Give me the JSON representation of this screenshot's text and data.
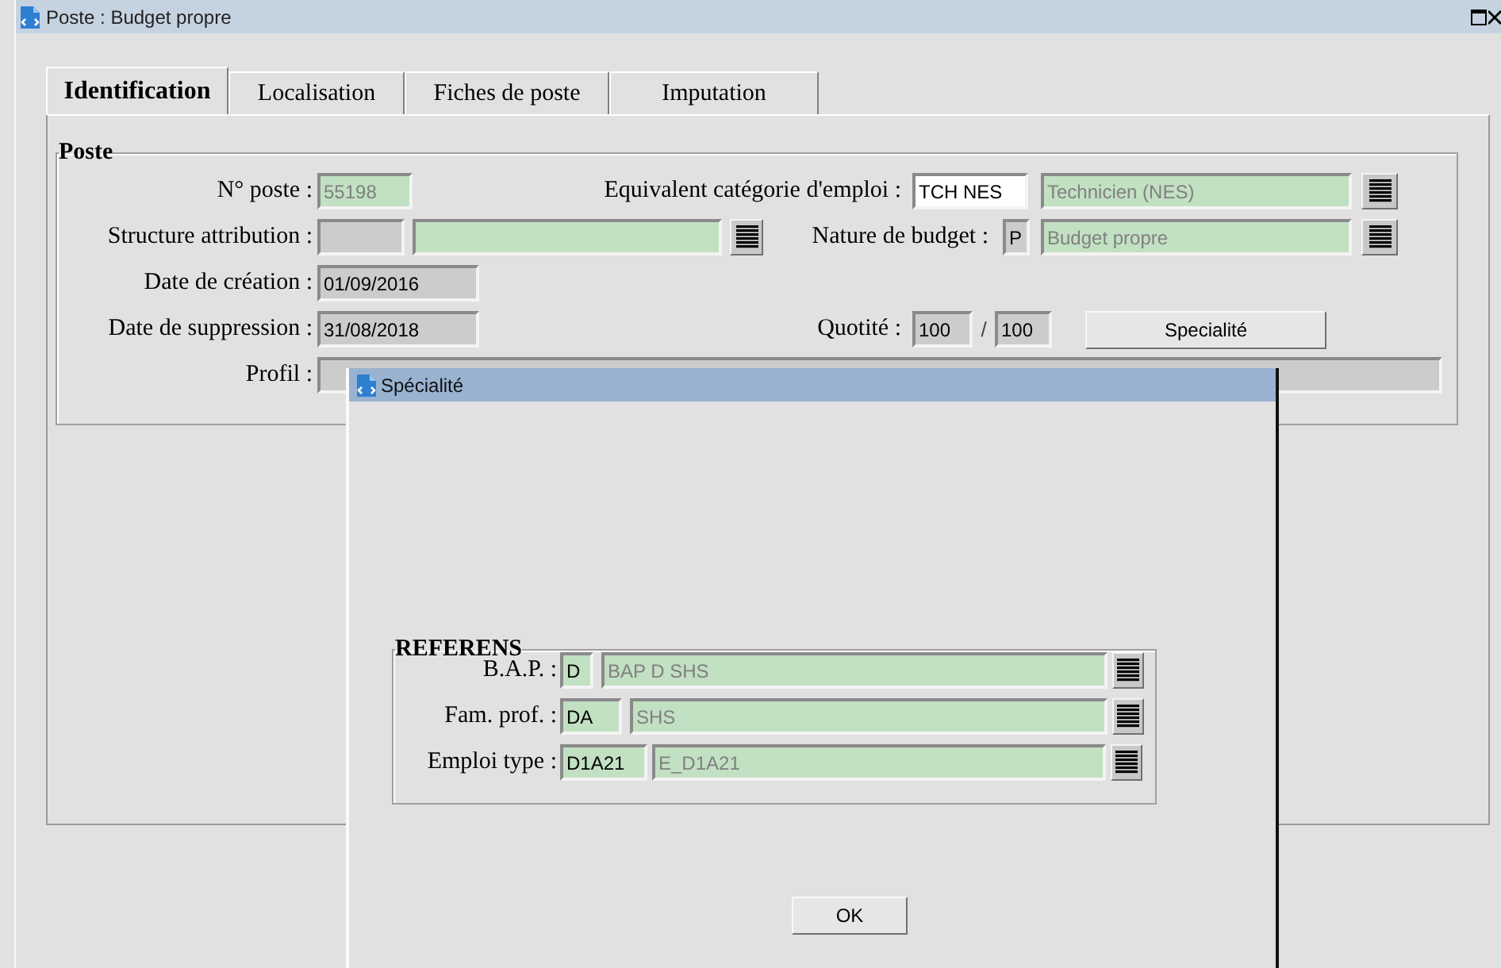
{
  "window": {
    "title": "Poste : Budget propre"
  },
  "tabs": [
    {
      "label": "Identification",
      "selected": true
    },
    {
      "label": "Localisation",
      "selected": false
    },
    {
      "label": "Fiches de poste",
      "selected": false
    },
    {
      "label": "Imputation",
      "selected": false
    }
  ],
  "poste_group": {
    "title": "Poste",
    "rows": [
      {
        "items": [
          {
            "kind": "label",
            "text": "N° poste :"
          },
          {
            "kind": "lookup",
            "value": "55198"
          },
          {
            "kind": "label",
            "text": "Equivalent catégorie d'emploi :"
          },
          {
            "kind": "input",
            "value": "TCH NES"
          },
          {
            "kind": "lookup",
            "value": "Technicien (NES)"
          },
          {
            "kind": "list-button"
          }
        ]
      },
      {
        "items": [
          {
            "kind": "label",
            "text": "Structure attribution :"
          },
          {
            "kind": "locked"
          },
          {
            "kind": "lookup"
          },
          {
            "kind": "list-button"
          },
          {
            "kind": "label",
            "text": "Nature de budget :"
          },
          {
            "kind": "locked",
            "value": "P"
          },
          {
            "kind": "lookup",
            "value": "Budget propre"
          },
          {
            "kind": "list-button"
          }
        ]
      },
      {
        "items": [
          {
            "kind": "label",
            "text": "Date de création :"
          },
          {
            "kind": "locked",
            "value": "01/09/2016"
          }
        ]
      },
      {
        "items": [
          {
            "kind": "label",
            "text": "Date de suppression :"
          },
          {
            "kind": "locked",
            "value": "31/08/2018"
          },
          {
            "kind": "label",
            "text": "Quotité :"
          },
          {
            "kind": "locked",
            "value": "100"
          },
          {
            "kind": "slash",
            "text": "/"
          },
          {
            "kind": "locked",
            "value": "100"
          },
          {
            "kind": "button",
            "text": "Specialité"
          }
        ]
      },
      {
        "items": [
          {
            "kind": "label",
            "text": "Profil :"
          },
          {
            "kind": "locked"
          }
        ]
      }
    ]
  },
  "dialog": {
    "title": "Spécialité",
    "group": {
      "title": "REFERENS",
      "rows": [
        {
          "items": [
            {
              "kind": "label",
              "text": "B.A.P. :"
            },
            {
              "kind": "code",
              "value": "D"
            },
            {
              "kind": "lookup",
              "value": "BAP D SHS"
            },
            {
              "kind": "list-button"
            }
          ]
        },
        {
          "items": [
            {
              "kind": "label",
              "text": "Fam. prof. :"
            },
            {
              "kind": "code",
              "value": "DA"
            },
            {
              "kind": "lookup",
              "value": "SHS"
            },
            {
              "kind": "list-button"
            }
          ]
        },
        {
          "items": [
            {
              "kind": "label",
              "text": "Emploi type :"
            },
            {
              "kind": "code",
              "value": "D1A21"
            },
            {
              "kind": "lookup",
              "value": "E_D1A21"
            },
            {
              "kind": "list-button"
            }
          ]
        }
      ]
    },
    "ok_button": "OK"
  }
}
